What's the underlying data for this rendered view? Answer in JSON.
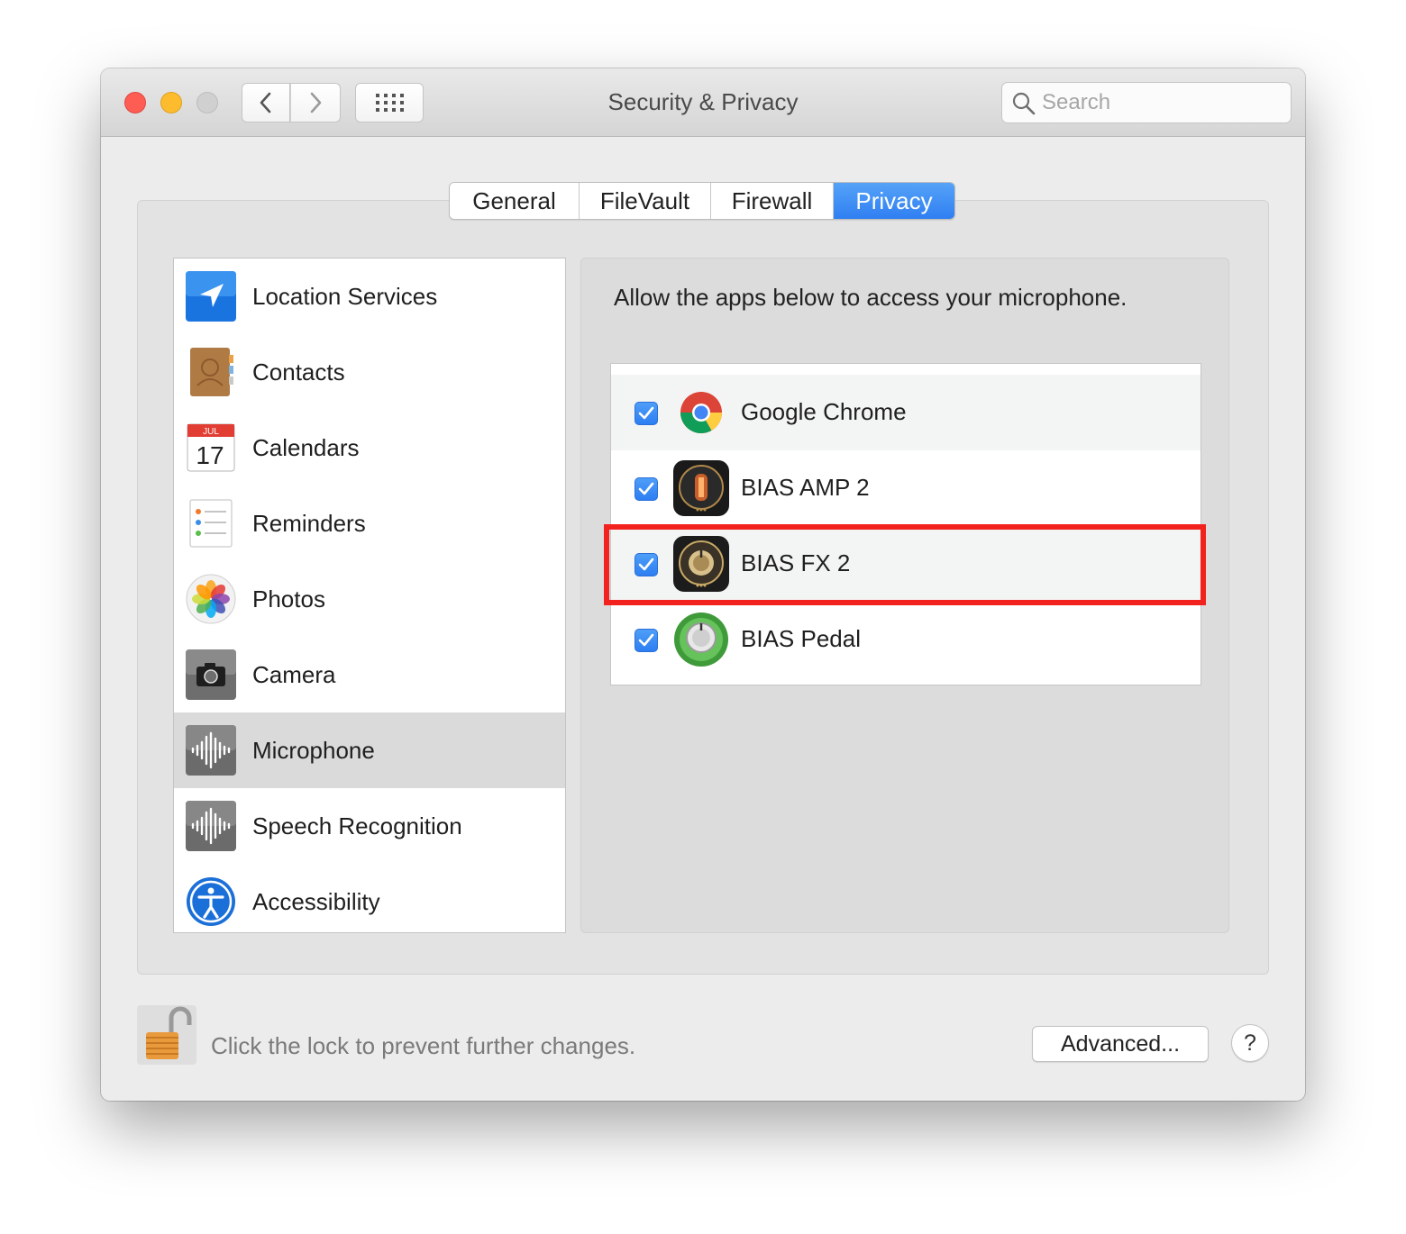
{
  "window": {
    "title": "Security & Privacy",
    "search_placeholder": "Search"
  },
  "tabs": [
    {
      "label": "General",
      "active": false
    },
    {
      "label": "FileVault",
      "active": false
    },
    {
      "label": "Firewall",
      "active": false
    },
    {
      "label": "Privacy",
      "active": true
    }
  ],
  "sidebar": {
    "selected": "Microphone",
    "items": [
      {
        "label": "Location Services",
        "icon": "location-arrow-icon"
      },
      {
        "label": "Contacts",
        "icon": "contacts-book-icon"
      },
      {
        "label": "Calendars",
        "icon": "calendar-icon",
        "icon_month": "JUL",
        "icon_day": "17"
      },
      {
        "label": "Reminders",
        "icon": "reminders-list-icon"
      },
      {
        "label": "Photos",
        "icon": "photos-flower-icon"
      },
      {
        "label": "Camera",
        "icon": "camera-icon"
      },
      {
        "label": "Microphone",
        "icon": "microphone-waveform-icon"
      },
      {
        "label": "Speech Recognition",
        "icon": "speech-waveform-icon"
      },
      {
        "label": "Accessibility",
        "icon": "accessibility-icon"
      }
    ]
  },
  "privacy_pane": {
    "prompt": "Allow the apps below to access your microphone.",
    "apps": [
      {
        "name": "Google Chrome",
        "checked": true,
        "icon": "chrome-icon"
      },
      {
        "name": "BIAS AMP 2",
        "checked": true,
        "icon": "bias-amp-tube-icon"
      },
      {
        "name": "BIAS FX 2",
        "checked": true,
        "icon": "bias-fx-knob-icon",
        "highlighted": true
      },
      {
        "name": "BIAS Pedal",
        "checked": true,
        "icon": "bias-pedal-knob-icon"
      }
    ],
    "highlight_color": "#f2231f"
  },
  "footer": {
    "lock_message": "Click the lock to prevent further changes.",
    "advanced_label": "Advanced...",
    "help_label": "?"
  },
  "colors": {
    "accent": "#2f7ff2",
    "close": "#fd5d53",
    "minimize": "#fdbc2e"
  }
}
